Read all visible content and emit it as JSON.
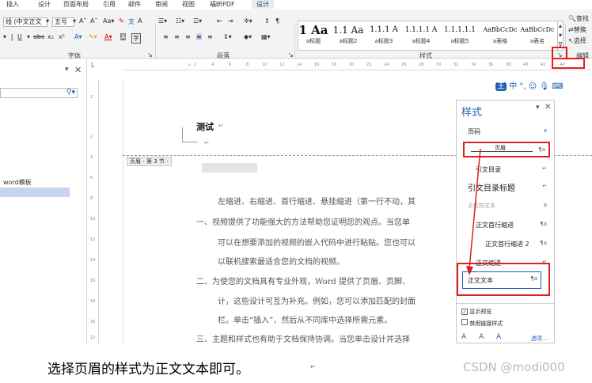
{
  "ribbon_tabs": [
    "插入",
    "设计",
    "页面布局",
    "引用",
    "邮件",
    "审阅",
    "视图",
    "福昕PDF",
    "设计"
  ],
  "font_group": {
    "font_name": "线 (中文正文",
    "font_size": "五号",
    "label": "字体"
  },
  "paragraph_group": {
    "label": "段落"
  },
  "styles_group": {
    "label": "样式",
    "items": [
      {
        "sample": "1 Aa",
        "name": "a标题",
        "bold": true
      },
      {
        "sample": "1.1 Aa",
        "name": "a标题2",
        "bold": false
      },
      {
        "sample": "1.1.1 A",
        "name": "a标题3",
        "bold": false
      },
      {
        "sample": "1.1.1.1 A",
        "name": "a标题4",
        "bold": false
      },
      {
        "sample": "1.1.1.1.1",
        "name": "a标题5",
        "bold": false
      },
      {
        "sample": "AaBbCcDc",
        "name": "a表格",
        "bold": false
      },
      {
        "sample": "AaBbCcDc",
        "name": "a表名",
        "bold": false
      }
    ]
  },
  "edit_group": {
    "label": "编辑",
    "items": [
      "查找",
      "替换",
      "选择"
    ]
  },
  "ruler": {
    "ticks": [
      "2",
      "4",
      "6",
      "8",
      "10",
      "12",
      "14",
      "16",
      "18",
      "20",
      "22",
      "24",
      "26",
      "28",
      "30",
      "32",
      "34",
      "36",
      "38",
      "40",
      "42",
      "44"
    ],
    "vticks": [
      "2",
      "2",
      "4",
      "6",
      "8",
      "10",
      "12",
      "14",
      "16",
      "18",
      "20",
      "22"
    ]
  },
  "nav_pane": {
    "search_icon": "search-icon",
    "item": "word模板"
  },
  "document": {
    "title": "测试",
    "header_tag": "页眉 - 第 3 节 -",
    "lines": [
      "左缩进、右缩进、首行缩进、悬挂缩进（第一行不动，其",
      "一、视频提供了功能强大的方法帮助您证明您的观点。当您单",
      "可以在想要添加的视频的嵌入代码中进行粘贴。您也可以",
      "以联机搜索最适合您的文档的视频。",
      "二、为使您的文档具有专业外观，Word 提供了页眉、页脚、",
      "计，这些设计可互为补充。例如，您可以添加匹配的封面",
      "栏。单击“插入”，然后从不同库中选择所需元素。",
      "三、主题和样式也有助于文档保持协调。当您单击设计并选择"
    ]
  },
  "styles_pane": {
    "title": "样式",
    "items": [
      {
        "label": "页码",
        "mark": "a"
      },
      {
        "label": "页眉",
        "mark": "¶a"
      },
      {
        "label": "引文目录",
        "mark": "↵"
      },
      {
        "label": "引文目录标题",
        "mark": "↵"
      },
      {
        "label": "占位符文本",
        "mark": "a"
      },
      {
        "label": "正文首行缩进",
        "mark": "¶a"
      },
      {
        "label": "正文首行缩进 2",
        "mark": "¶a"
      },
      {
        "label": "正文缩进",
        "mark": "↵"
      },
      {
        "label": "正文文本",
        "mark": "¶a"
      }
    ],
    "show_preview_label": "显示预览",
    "show_preview_checked": true,
    "disable_linked_label": "禁用链接样式",
    "disable_linked_checked": false,
    "options_link": "选项..."
  },
  "caption": "选择页眉的样式为正文文本即可。",
  "watermark": "CSDN @modi000",
  "accent_color": "#2b579a",
  "highlight_color": "#e02020"
}
